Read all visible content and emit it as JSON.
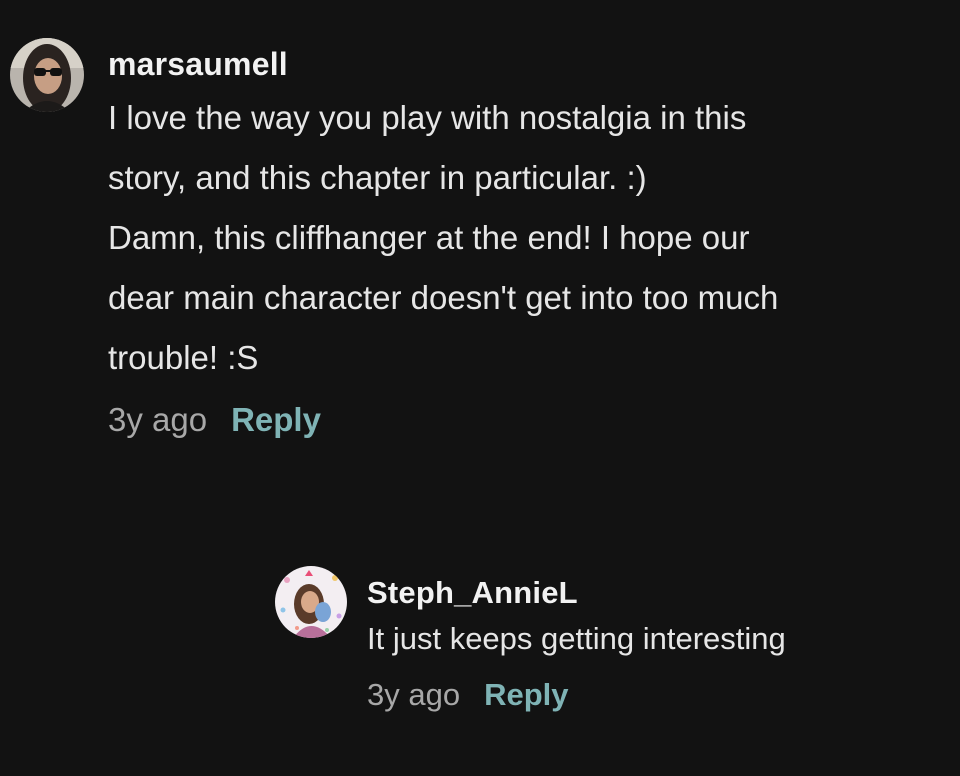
{
  "comments": [
    {
      "username": "marsaumell",
      "avatar_icon": "user-avatar-photo",
      "text": "I love the way you play with nostalgia in this\nstory, and this chapter in particular. :)\nDamn, this cliffhanger at the end! I hope our\ndear main character doesn't get into too much\ntrouble! :S",
      "time": "3y ago",
      "reply_label": "Reply"
    }
  ],
  "replies": [
    {
      "username": "Steph_AnnieL",
      "avatar_icon": "user-avatar-illustration",
      "text": "It just keeps getting interesting",
      "time": "3y ago",
      "reply_label": "Reply"
    }
  ],
  "colors": {
    "background": "#121212",
    "reply_accent": "#7fb3b5",
    "timestamp": "#a8a8a8"
  }
}
